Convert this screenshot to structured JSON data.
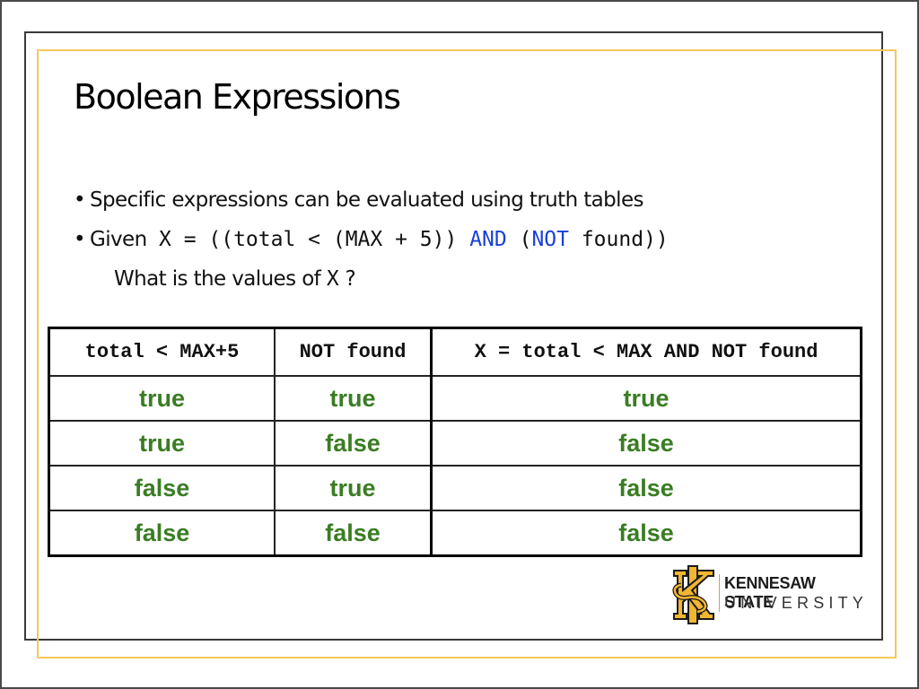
{
  "slide": {
    "title": "Boolean Expressions",
    "bullets": [
      {
        "text": "Specific expressions can be evaluated using truth tables"
      },
      {
        "prefix": "Given",
        "code_start": "X = ((total < (MAX + 5)) ",
        "kw_and": "AND",
        "code_mid": " (",
        "kw_not": "NOT",
        "code_end": " found))"
      },
      {
        "text": "What is the values of",
        "code": "X",
        "suffix": "?"
      }
    ],
    "colors": {
      "keyword": "#1a3fd8",
      "table_values": "#3a7d23",
      "gold_accent": "#f5c85a"
    }
  },
  "truth_table": {
    "headers": [
      "total < MAX+5",
      "NOT found",
      "X = total < MAX AND NOT found"
    ],
    "rows": [
      [
        "true",
        "true",
        "true"
      ],
      [
        "true",
        "false",
        "false"
      ],
      [
        "false",
        "true",
        "false"
      ],
      [
        "false",
        "false",
        "false"
      ]
    ]
  },
  "logo": {
    "line1": "KENNESAW STATE",
    "line2": "UNIVERSITY",
    "icon": "ksu-monogram-icon"
  }
}
